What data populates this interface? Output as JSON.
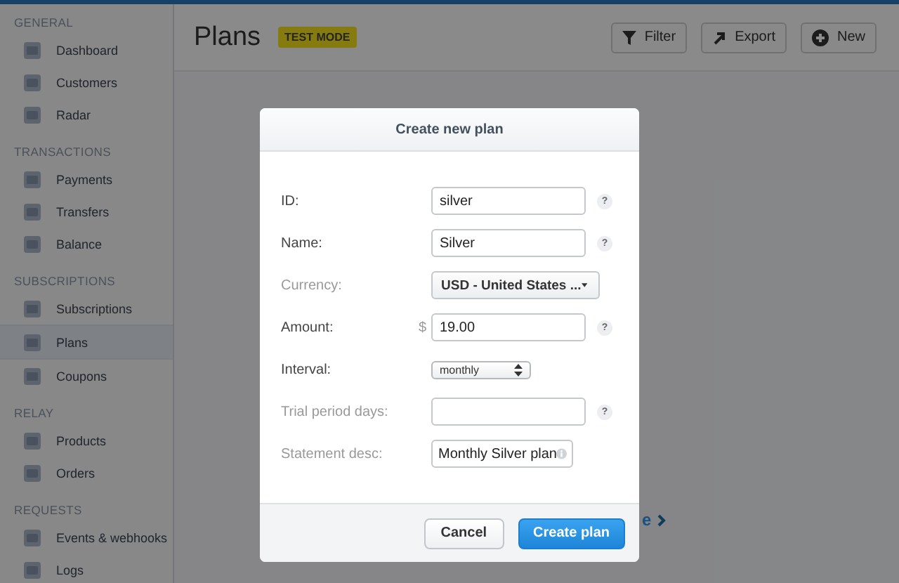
{
  "sidebar": {
    "sections": [
      {
        "title": "GENERAL",
        "items": [
          {
            "label": "Dashboard",
            "selected": false
          },
          {
            "label": "Customers",
            "selected": false
          },
          {
            "label": "Radar",
            "selected": false
          }
        ]
      },
      {
        "title": "TRANSACTIONS",
        "items": [
          {
            "label": "Payments",
            "selected": false
          },
          {
            "label": "Transfers",
            "selected": false
          },
          {
            "label": "Balance",
            "selected": false
          }
        ]
      },
      {
        "title": "SUBSCRIPTIONS",
        "items": [
          {
            "label": "Subscriptions",
            "selected": false
          },
          {
            "label": "Plans",
            "selected": true
          },
          {
            "label": "Coupons",
            "selected": false
          }
        ]
      },
      {
        "title": "RELAY",
        "items": [
          {
            "label": "Products",
            "selected": false
          },
          {
            "label": "Orders",
            "selected": false
          }
        ]
      },
      {
        "title": "REQUESTS",
        "items": [
          {
            "label": "Events & webhooks",
            "selected": false
          },
          {
            "label": "Logs",
            "selected": false
          }
        ]
      }
    ]
  },
  "header": {
    "title": "Plans",
    "badge": "TEST MODE",
    "actions": [
      {
        "label": "Filter"
      },
      {
        "label": "Export"
      },
      {
        "label": "New"
      }
    ]
  },
  "background_link": "e",
  "modal": {
    "title": "Create new plan",
    "fields": [
      {
        "kind": "text",
        "label": "ID:",
        "value": "silver",
        "muted": false,
        "help": "?"
      },
      {
        "kind": "text",
        "label": "Name:",
        "value": "Silver",
        "muted": false,
        "help": "?"
      },
      {
        "kind": "select",
        "label": "Currency:",
        "value": "USD - United States ...",
        "muted": true
      },
      {
        "kind": "text",
        "label": "Amount:",
        "prefix": "$",
        "value": "19.00",
        "muted": false,
        "help": "?"
      },
      {
        "kind": "small-select",
        "label": "Interval:",
        "value": "monthly",
        "muted": false
      },
      {
        "kind": "text",
        "label": "Trial period days:",
        "muted": true,
        "help": "?"
      },
      {
        "kind": "info-text",
        "label": "Statement desc:",
        "value": "Monthly Silver plan",
        "muted": true
      }
    ],
    "buttons": [
      {
        "label": "Cancel",
        "primary": false
      },
      {
        "label": "Create plan",
        "primary": true
      }
    ]
  }
}
